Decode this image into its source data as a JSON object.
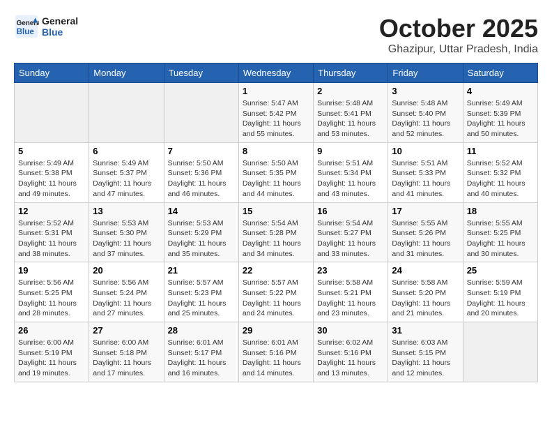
{
  "logo": {
    "line1": "General",
    "line2": "Blue"
  },
  "title": "October 2025",
  "location": "Ghazipur, Uttar Pradesh, India",
  "weekdays": [
    "Sunday",
    "Monday",
    "Tuesday",
    "Wednesday",
    "Thursday",
    "Friday",
    "Saturday"
  ],
  "weeks": [
    [
      {
        "day": "",
        "info": ""
      },
      {
        "day": "",
        "info": ""
      },
      {
        "day": "",
        "info": ""
      },
      {
        "day": "1",
        "info": "Sunrise: 5:47 AM\nSunset: 5:42 PM\nDaylight: 11 hours and 55 minutes."
      },
      {
        "day": "2",
        "info": "Sunrise: 5:48 AM\nSunset: 5:41 PM\nDaylight: 11 hours and 53 minutes."
      },
      {
        "day": "3",
        "info": "Sunrise: 5:48 AM\nSunset: 5:40 PM\nDaylight: 11 hours and 52 minutes."
      },
      {
        "day": "4",
        "info": "Sunrise: 5:49 AM\nSunset: 5:39 PM\nDaylight: 11 hours and 50 minutes."
      }
    ],
    [
      {
        "day": "5",
        "info": "Sunrise: 5:49 AM\nSunset: 5:38 PM\nDaylight: 11 hours and 49 minutes."
      },
      {
        "day": "6",
        "info": "Sunrise: 5:49 AM\nSunset: 5:37 PM\nDaylight: 11 hours and 47 minutes."
      },
      {
        "day": "7",
        "info": "Sunrise: 5:50 AM\nSunset: 5:36 PM\nDaylight: 11 hours and 46 minutes."
      },
      {
        "day": "8",
        "info": "Sunrise: 5:50 AM\nSunset: 5:35 PM\nDaylight: 11 hours and 44 minutes."
      },
      {
        "day": "9",
        "info": "Sunrise: 5:51 AM\nSunset: 5:34 PM\nDaylight: 11 hours and 43 minutes."
      },
      {
        "day": "10",
        "info": "Sunrise: 5:51 AM\nSunset: 5:33 PM\nDaylight: 11 hours and 41 minutes."
      },
      {
        "day": "11",
        "info": "Sunrise: 5:52 AM\nSunset: 5:32 PM\nDaylight: 11 hours and 40 minutes."
      }
    ],
    [
      {
        "day": "12",
        "info": "Sunrise: 5:52 AM\nSunset: 5:31 PM\nDaylight: 11 hours and 38 minutes."
      },
      {
        "day": "13",
        "info": "Sunrise: 5:53 AM\nSunset: 5:30 PM\nDaylight: 11 hours and 37 minutes."
      },
      {
        "day": "14",
        "info": "Sunrise: 5:53 AM\nSunset: 5:29 PM\nDaylight: 11 hours and 35 minutes."
      },
      {
        "day": "15",
        "info": "Sunrise: 5:54 AM\nSunset: 5:28 PM\nDaylight: 11 hours and 34 minutes."
      },
      {
        "day": "16",
        "info": "Sunrise: 5:54 AM\nSunset: 5:27 PM\nDaylight: 11 hours and 33 minutes."
      },
      {
        "day": "17",
        "info": "Sunrise: 5:55 AM\nSunset: 5:26 PM\nDaylight: 11 hours and 31 minutes."
      },
      {
        "day": "18",
        "info": "Sunrise: 5:55 AM\nSunset: 5:25 PM\nDaylight: 11 hours and 30 minutes."
      }
    ],
    [
      {
        "day": "19",
        "info": "Sunrise: 5:56 AM\nSunset: 5:25 PM\nDaylight: 11 hours and 28 minutes."
      },
      {
        "day": "20",
        "info": "Sunrise: 5:56 AM\nSunset: 5:24 PM\nDaylight: 11 hours and 27 minutes."
      },
      {
        "day": "21",
        "info": "Sunrise: 5:57 AM\nSunset: 5:23 PM\nDaylight: 11 hours and 25 minutes."
      },
      {
        "day": "22",
        "info": "Sunrise: 5:57 AM\nSunset: 5:22 PM\nDaylight: 11 hours and 24 minutes."
      },
      {
        "day": "23",
        "info": "Sunrise: 5:58 AM\nSunset: 5:21 PM\nDaylight: 11 hours and 23 minutes."
      },
      {
        "day": "24",
        "info": "Sunrise: 5:58 AM\nSunset: 5:20 PM\nDaylight: 11 hours and 21 minutes."
      },
      {
        "day": "25",
        "info": "Sunrise: 5:59 AM\nSunset: 5:19 PM\nDaylight: 11 hours and 20 minutes."
      }
    ],
    [
      {
        "day": "26",
        "info": "Sunrise: 6:00 AM\nSunset: 5:19 PM\nDaylight: 11 hours and 19 minutes."
      },
      {
        "day": "27",
        "info": "Sunrise: 6:00 AM\nSunset: 5:18 PM\nDaylight: 11 hours and 17 minutes."
      },
      {
        "day": "28",
        "info": "Sunrise: 6:01 AM\nSunset: 5:17 PM\nDaylight: 11 hours and 16 minutes."
      },
      {
        "day": "29",
        "info": "Sunrise: 6:01 AM\nSunset: 5:16 PM\nDaylight: 11 hours and 14 minutes."
      },
      {
        "day": "30",
        "info": "Sunrise: 6:02 AM\nSunset: 5:16 PM\nDaylight: 11 hours and 13 minutes."
      },
      {
        "day": "31",
        "info": "Sunrise: 6:03 AM\nSunset: 5:15 PM\nDaylight: 11 hours and 12 minutes."
      },
      {
        "day": "",
        "info": ""
      }
    ]
  ]
}
